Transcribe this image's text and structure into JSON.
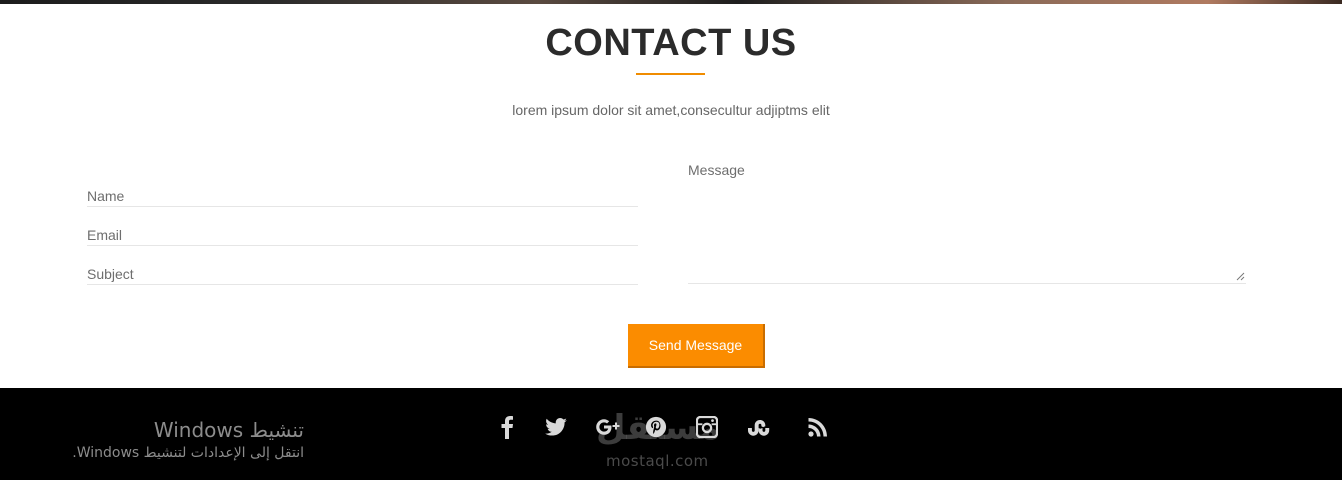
{
  "contact": {
    "title": "CONTACT US",
    "subtitle": "lorem ipsum dolor sit amet,consecultur adjiptms elit",
    "accent_color": "#f08c00"
  },
  "form": {
    "name_placeholder": "Name",
    "email_placeholder": "Email",
    "subject_placeholder": "Subject",
    "message_placeholder": "Message",
    "send_label": "Send Message",
    "button_color": "#fb8c00"
  },
  "footer": {
    "background": "#000000",
    "social_icons": [
      "facebook-icon",
      "twitter-icon",
      "google-plus-icon",
      "pinterest-icon",
      "instagram-icon",
      "stumbleupon-icon",
      "rss-icon"
    ]
  },
  "windows_activation": {
    "title": "تنشيط Windows",
    "subtitle": "انتقل إلى الإعدادات لتنشيط Windows."
  },
  "watermark": {
    "arabic": "مستقل",
    "text": "mostaql.com"
  }
}
